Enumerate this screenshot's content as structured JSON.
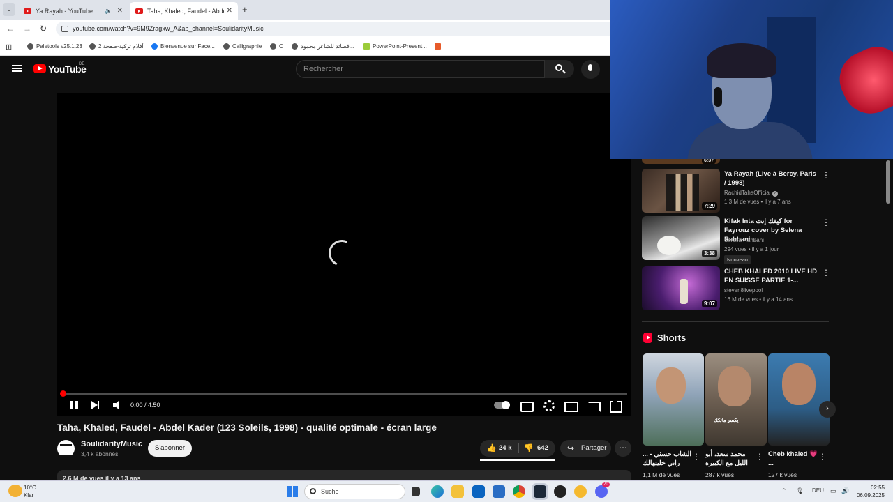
{
  "browser": {
    "tabs": [
      {
        "title": "Ya Rayah - YouTube",
        "active": false
      },
      {
        "title": "Taha, Khaled, Faudel - Abdel Ka",
        "active": true
      }
    ],
    "url": "youtube.com/watch?v=9M9Zragxw_A&ab_channel=SoulidarityMusic",
    "bookmarks": [
      "Paletools v25.1.23",
      "أفلام تركية-صفحة 2",
      "Bienvenue sur Face...",
      "Calligraphie",
      "C",
      "قصائد للشاعر محمود...",
      "PowerPoint-Present..."
    ]
  },
  "youtube": {
    "logo_text": "YouTube",
    "country": "DE",
    "search_placeholder": "Rechercher"
  },
  "player": {
    "time": "0:00 / 4:50",
    "progress": 0.0
  },
  "video": {
    "title": "Taha, Khaled, Faudel - Abdel Kader (123 Soleils, 1998) - qualité optimale - écran large",
    "channel": "SoulidarityMusic",
    "subscribers": "3,4 k abonnés",
    "subscribe_label": "S'abonner",
    "likes": "24 k",
    "dislikes": "642",
    "share_label": "Partager",
    "description_line": "2,6 M de vues  il y a 13 ans"
  },
  "recommendations": [
    {
      "title": "Ya Rayah (Live à Bercy, Paris / 1998)",
      "channel": "RachidTahaOfficial",
      "verified": true,
      "meta": "1,3 M de vues • il y a 7 ans",
      "duration": "7:29"
    },
    {
      "title": "Kifak Inta كيفك إنت for Fayrouz cover by Selena Rahbani ...",
      "channel": "Selena Rahbani",
      "meta": "294 vues • il y a 1 jour",
      "badge": "Nouveau",
      "duration": "3:38"
    },
    {
      "title": "CHEB KHALED 2010 LIVE HD EN SUISSE PARTIE 1-...",
      "channel": "steven8livepool",
      "meta": "16 M de vues • il y a 14 ans",
      "duration": "9:07"
    }
  ],
  "partial_duration": "6:37",
  "shorts": {
    "heading": "Shorts",
    "items": [
      {
        "title": "الشاب حسني - ... راني خليتهالك",
        "views": "1,1 M de vues"
      },
      {
        "title": "محمد سعد، أبو الليل مع الكبيرة",
        "views": "287 k vues"
      },
      {
        "title": "Cheb khaled 💗 ...",
        "views": "127 k vues"
      }
    ],
    "overlay_text": "يكسر ماتكك"
  },
  "taskbar": {
    "temperature": "10°C",
    "condition": "Klar",
    "search_label": "Suche",
    "language": "DEU",
    "time": "02:55",
    "date": "06.09.2025",
    "discord_badge": "20"
  }
}
